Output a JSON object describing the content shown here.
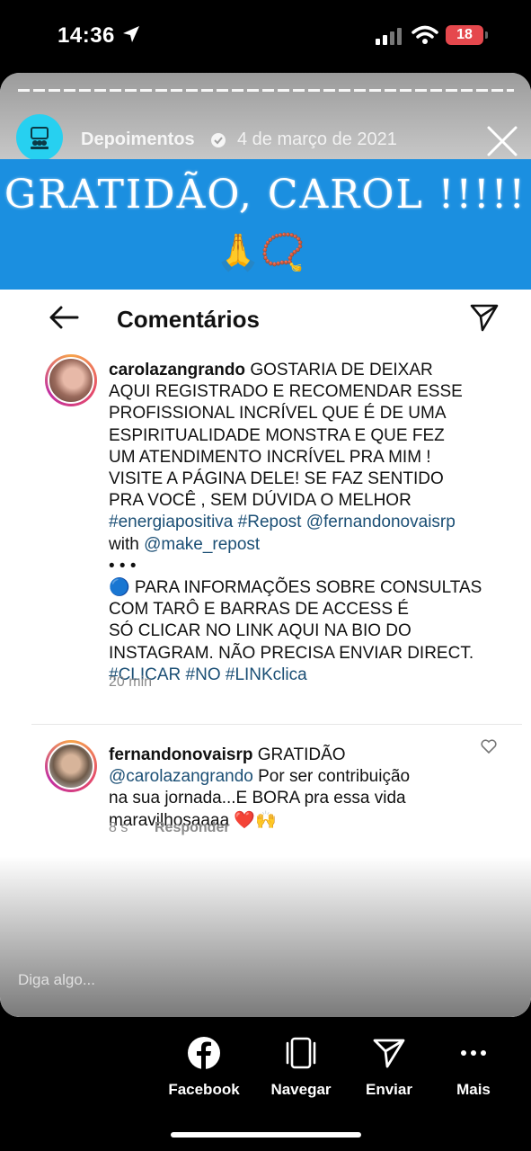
{
  "status_bar": {
    "time": "14:36",
    "battery": "18"
  },
  "story": {
    "username": "Depoimentos",
    "date": "4 de março de 2021",
    "banner_text": "GRATIDÃO, CAROL !!!!!",
    "banner_emoji": "🙏📿"
  },
  "comments_screen": {
    "title": "Comentários",
    "comments": [
      {
        "username": "carolazangrando",
        "text_plain": " GOSTARIA DE DEIXAR\nAQUI REGISTRADO E RECOMENDAR ESSE\nPROFISSIONAL INCRÍVEL QUE É DE UMA\nESPIRITUALIDADE MONSTRA E QUE FEZ\nUM ATENDIMENTO INCRÍVEL PRA MIM !\nVISITE A PÁGINA DELE! SE FAZ SENTIDO\nPRA VOCÊ , SEM DÚVIDA O MELHOR\n",
        "hashtags_line": "#energiapositiva #Repost @fernandonovaisrp",
        "with_label": "with ",
        "with_mention": "@make_repost",
        "dots": "•   •   •",
        "info_text": "🔵 PARA INFORMAÇÕES SOBRE CONSULTAS\nCOM TARÔ E BARRAS DE ACCESS É\nSÓ CLICAR NO LINK AQUI NA BIO DO\nINSTAGRAM. NÃO PRECISA ENVIAR DIRECT.",
        "tags_line": "#CLICAR #NO #LINKclica",
        "time": "20 min"
      },
      {
        "username": "fernandonovaisrp",
        "text_start": " GRATIDÃO",
        "mention": "@carolazangrando",
        "text_end": " Por ser contribuição\nna sua jornada...E BORA pra essa vida\nmaravilhosaaaa ❤️🙌",
        "time": "8 s",
        "reply_label": "Responder"
      }
    ]
  },
  "reply_placeholder": "Diga algo...",
  "actions": [
    {
      "label": "Facebook",
      "icon": "facebook-icon"
    },
    {
      "label": "Navegar",
      "icon": "browse-icon"
    },
    {
      "label": "Enviar",
      "icon": "send-icon"
    },
    {
      "label": "Mais",
      "icon": "more-icon"
    }
  ]
}
